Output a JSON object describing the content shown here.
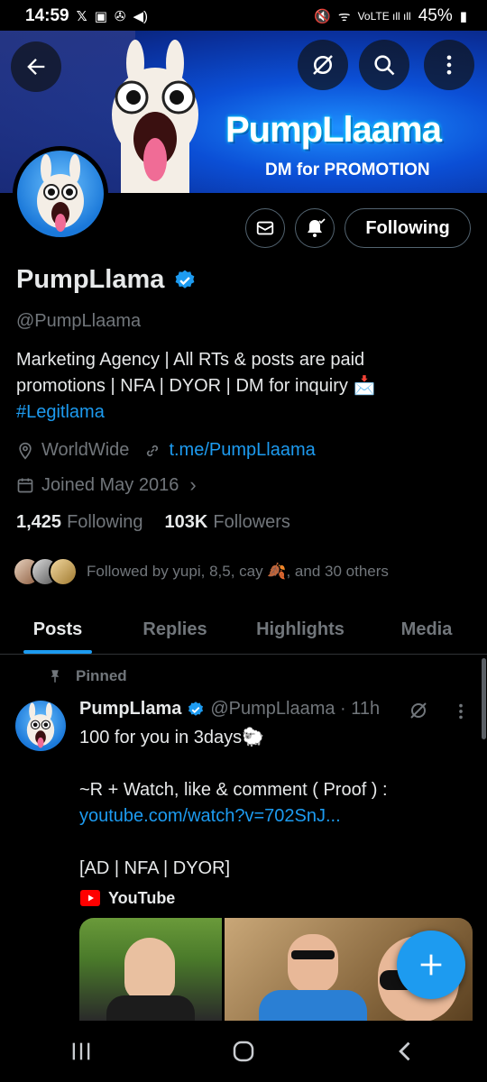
{
  "status": {
    "time": "14:59",
    "battery": "45%"
  },
  "banner": {
    "title": "PumpLlaama",
    "subtitle": "DM for PROMOTION"
  },
  "profile": {
    "name": "PumpLlama",
    "handle": "@PumpLlaama",
    "bio_line1": "Marketing Agency | All RTs & posts are paid",
    "bio_line2": "promotions | NFA | DYOR | DM for inquiry 📩",
    "hashtag": "#Legitlama",
    "location": "WorldWide",
    "link": "t.me/PumpLlaama",
    "joined": "Joined May 2016",
    "following_count": "1,425",
    "following_label": "Following",
    "followers_count": "103K",
    "followers_label": "Followers",
    "followed_by": "Followed by yupi, 8,5, cay 🍂, and 30 others",
    "follow_button": "Following"
  },
  "tabs": [
    "Posts",
    "Replies",
    "Highlights",
    "Media"
  ],
  "post": {
    "pinned_label": "Pinned",
    "author": "PumpLlama",
    "handle_time": "@PumpLlaama · 11h",
    "line1": "100 for you in 3days🐑",
    "line2": "~R + Watch, like & comment ( Proof ) :",
    "link": "youtube.com/watch?v=702SnJ...",
    "line3": "[AD | NFA | DYOR]",
    "source": "YouTube"
  },
  "colors": {
    "accent": "#1d9bf0",
    "muted": "#71767b",
    "text": "#e7e9ea",
    "background": "#000000"
  }
}
